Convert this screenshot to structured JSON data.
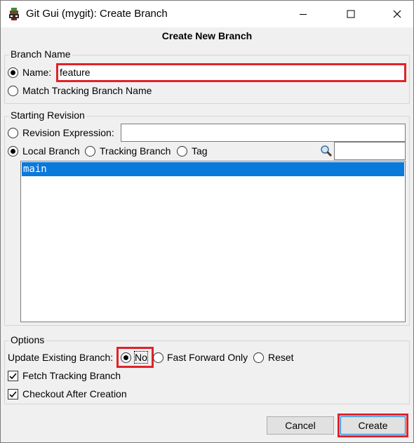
{
  "window": {
    "title": "Git Gui (mygit): Create Branch",
    "controls": {
      "minimize": "minimize-icon",
      "maximize": "maximize-icon",
      "close": "close-icon"
    }
  },
  "dialog_title": "Create New Branch",
  "branch_name": {
    "group_label": "Branch Name",
    "name_option_label": "Name:",
    "name_value": "feature",
    "match_tracking_label": "Match Tracking Branch Name",
    "selected": "name"
  },
  "starting_revision": {
    "group_label": "Starting Revision",
    "revision_expression_label": "Revision Expression:",
    "revision_expression_value": "",
    "local_branch_label": "Local Branch",
    "tracking_branch_label": "Tracking Branch",
    "tag_label": "Tag",
    "selected": "local_branch",
    "filter_value": "",
    "filter_icon": "search-icon",
    "branches": [
      "main"
    ],
    "selected_branch": "main"
  },
  "options": {
    "group_label": "Options",
    "update_existing_label": "Update Existing Branch:",
    "update_choices": [
      "No",
      "Fast Forward Only",
      "Reset"
    ],
    "update_selected": "No",
    "fetch_tracking_label": "Fetch Tracking Branch",
    "fetch_tracking_checked": true,
    "checkout_label": "Checkout After Creation",
    "checkout_checked": true
  },
  "buttons": {
    "cancel": "Cancel",
    "create": "Create"
  },
  "colors": {
    "highlight": "#e0222a",
    "selection": "#0a79dc",
    "background": "#f0f0f0"
  }
}
